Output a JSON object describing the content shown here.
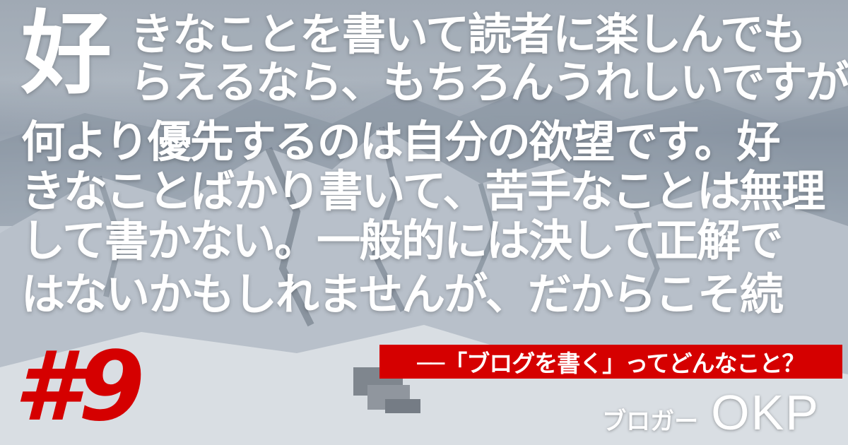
{
  "quote": {
    "first_char": "好",
    "lines": [
      "きなことを書いて読者に楽しんでも",
      "らえるなら、もちろんうれしいですが、",
      "何より優先するのは自分の欲望です。好",
      "きなことばかり書いて、苦手なことは無理",
      "して書かない。一般的には決して正解で",
      "はないかもしれませんが、だからこそ続"
    ]
  },
  "subtitle": "──「ブログを書く」ってどんなこと？",
  "episode": "#9",
  "author": {
    "role": "ブロガー",
    "name": "OKP"
  },
  "colors": {
    "accent": "#d50000",
    "text": "#ffffff"
  }
}
